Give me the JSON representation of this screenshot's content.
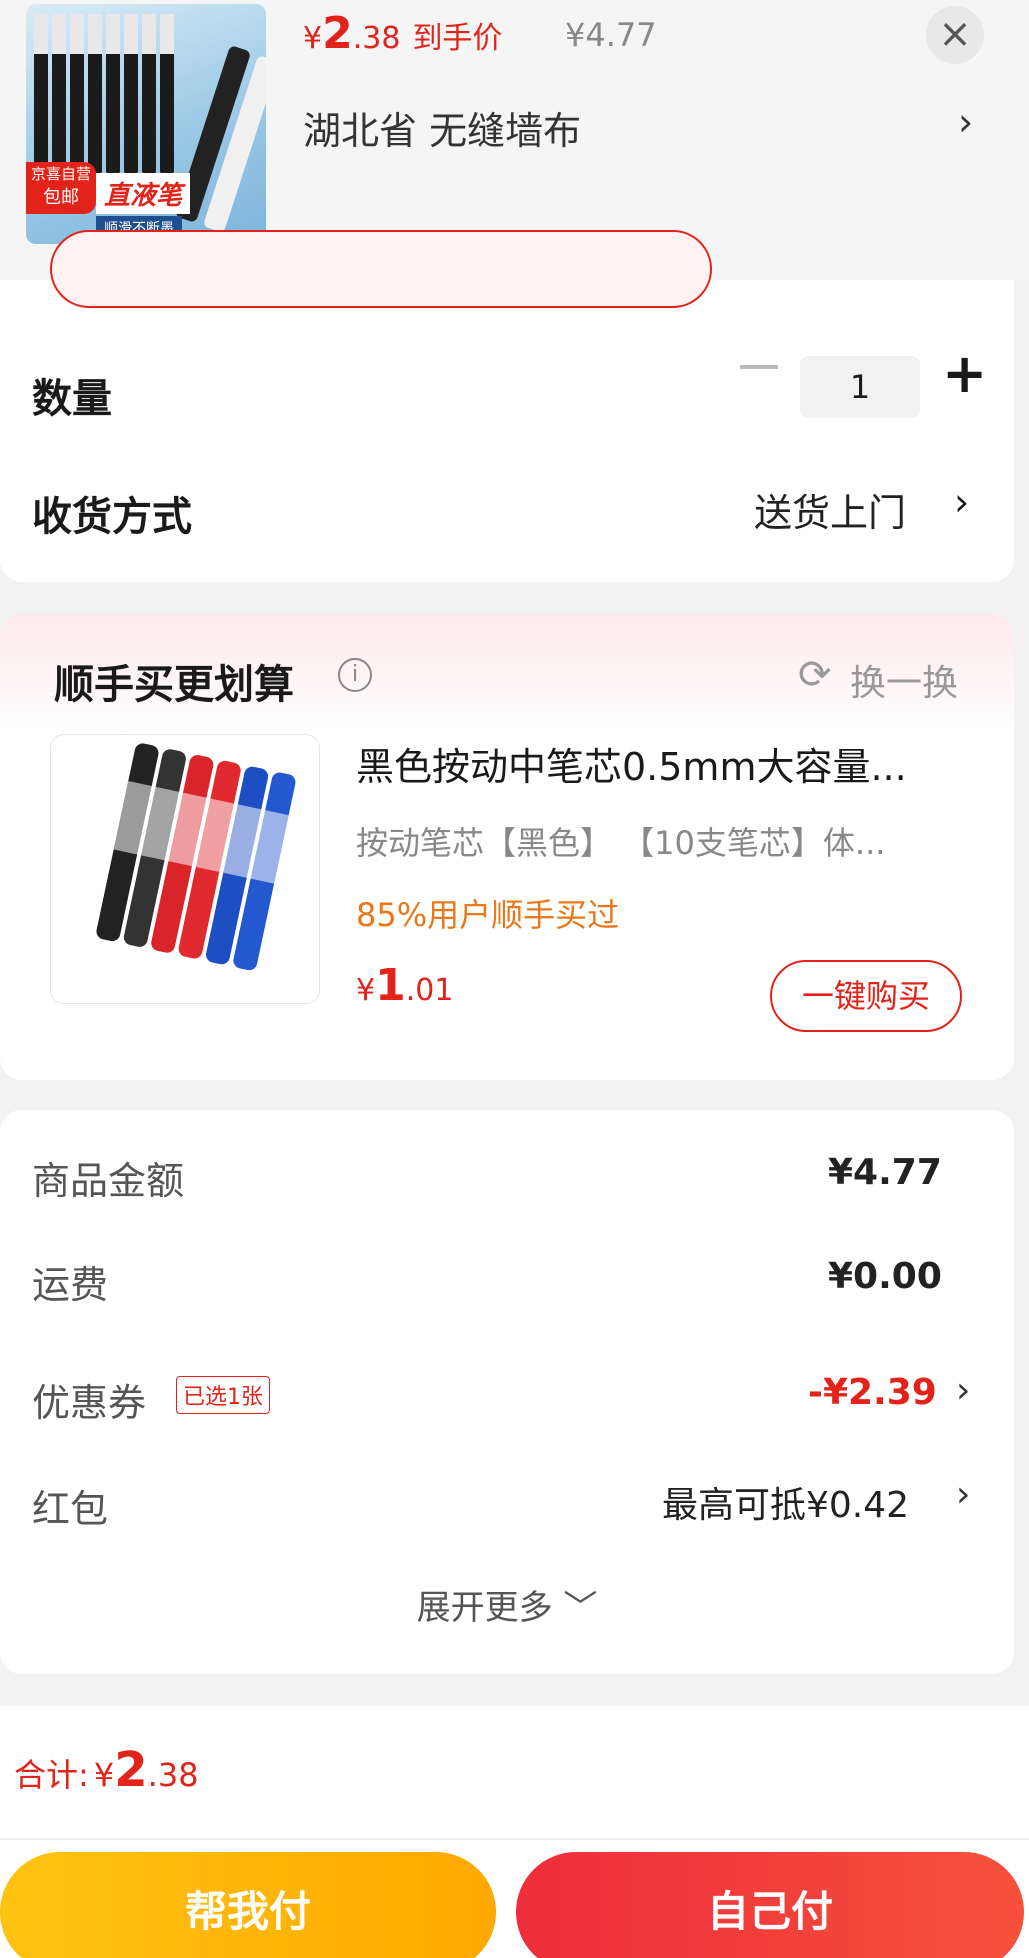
{
  "header": {
    "thumb_badge_top": "京喜自营",
    "thumb_badge_bottom": "包邮",
    "thumb_label": "直液笔",
    "thumb_sub": "顺滑不断墨",
    "price_currency": "¥",
    "price_int": "2",
    "price_dec": ".38",
    "price_label": "到手价",
    "original_price": "¥4.77",
    "close_icon": "×",
    "address": "湖北省  无缝墙布",
    "arrow": "›"
  },
  "order": {
    "quantity_label": "数量",
    "quantity_value": "1",
    "minus": "−",
    "plus": "+",
    "shipping_label": "收货方式",
    "shipping_value": "送货上门",
    "arrow": "›"
  },
  "addon": {
    "title": "顺手买更划算",
    "info_icon": "i",
    "refresh_icon": "⟳",
    "refresh_label": "换一换",
    "product_title": "黑色按动中笔芯0.5mm大容量...",
    "product_spec": "按动笔芯【黑色】   【10支笔芯】体...",
    "social_proof": "85%用户顺手买过",
    "price_currency": "¥",
    "price_int": "1",
    "price_dec": ".01",
    "buy_label": "一键购买"
  },
  "fees": {
    "goods_label": "商品金额",
    "goods_value": "¥4.77",
    "freight_label": "运费",
    "freight_value": "¥0.00",
    "coupon_label": "优惠券",
    "coupon_tag": "已选1张",
    "coupon_value": "-¥2.39",
    "redpacket_label": "红包",
    "redpacket_value": "最高可抵¥0.42",
    "arrow": "›",
    "expand_label": "展开更多 ﹀"
  },
  "footer": {
    "total_label": "合计:",
    "total_currency": "¥",
    "total_int": "2",
    "total_dec": ".38",
    "help_pay": "帮我付",
    "self_pay": "自己付"
  },
  "colors": {
    "accent": "#e2231a",
    "orange": "#e8781a",
    "yellow_button": "#ffb300",
    "red_button": "#f03a3c"
  }
}
